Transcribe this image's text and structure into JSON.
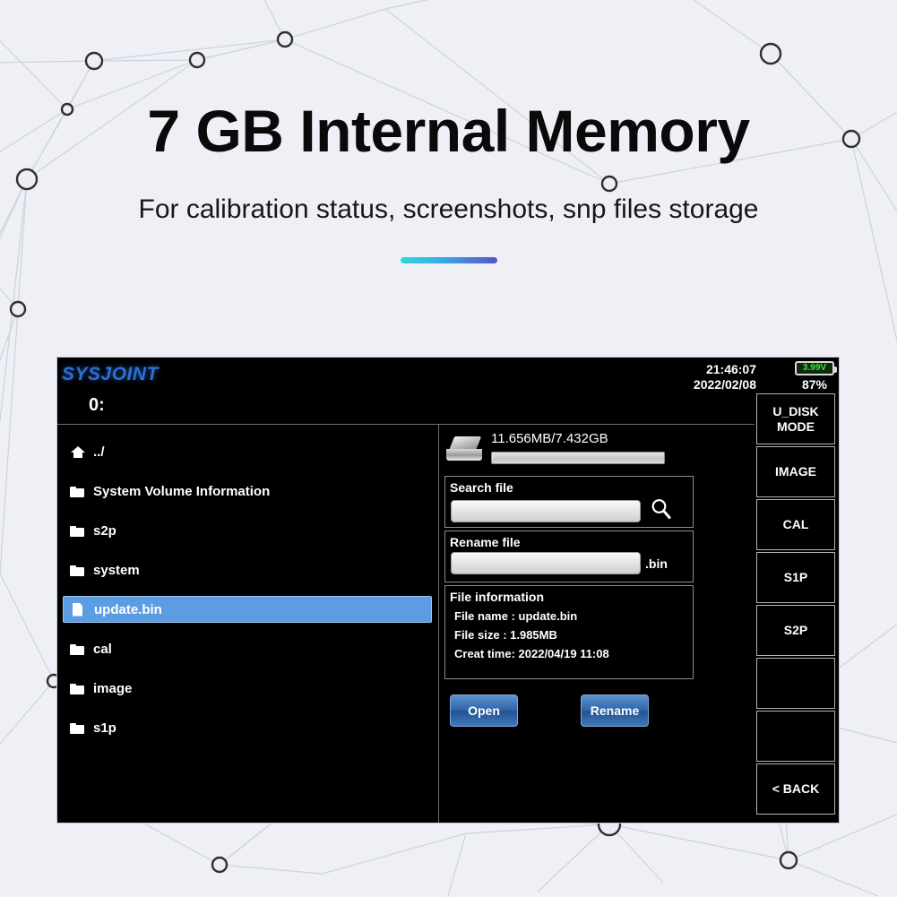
{
  "promo": {
    "title": "7 GB Internal Memory",
    "subtitle": "For calibration status, screenshots, snp files storage",
    "accent_gradient_from": "#2fd8e0",
    "accent_gradient_to": "#5a51c8",
    "background_color": "#eef0f6"
  },
  "device": {
    "brand": "SYSJOINT",
    "brand_color": "#2f6fd4",
    "drive_label": "0:",
    "status": {
      "time": "21:46:07",
      "date": "2022/02/08",
      "battery_voltage": "3.99V",
      "battery_percent": "87%",
      "battery_text_color": "#3ee43e"
    },
    "storage": {
      "used_total": "11.656MB/7.432GB",
      "fill_percent": 1,
      "drive_icon": "hard-drive-icon"
    },
    "file_list": [
      {
        "name": "../",
        "icon": "home-icon",
        "selected": false
      },
      {
        "name": "System Volume Information",
        "icon": "folder-icon",
        "selected": false
      },
      {
        "name": "s2p",
        "icon": "folder-icon",
        "selected": false
      },
      {
        "name": "system",
        "icon": "folder-icon",
        "selected": false
      },
      {
        "name": "update.bin",
        "icon": "file-icon",
        "selected": true
      },
      {
        "name": "cal",
        "icon": "folder-icon",
        "selected": false
      },
      {
        "name": "image",
        "icon": "folder-icon",
        "selected": false
      },
      {
        "name": "s1p",
        "icon": "folder-icon",
        "selected": false
      }
    ],
    "selection_color": "#5b9ce2",
    "search": {
      "label": "Search file",
      "value": "",
      "placeholder": "",
      "icon": "search-icon"
    },
    "rename": {
      "label": "Rename file",
      "value": "",
      "placeholder": "",
      "extension": ".bin"
    },
    "file_information": {
      "label": "File information",
      "file_name": "File name : update.bin",
      "file_size": "File size    : 1.985MB",
      "creat_time": "Creat time: 2022/04/19 11:08"
    },
    "actions": {
      "open": "Open",
      "rename": "Rename"
    },
    "soft_keys": [
      {
        "line1": "U_DISK",
        "line2": "MODE"
      },
      {
        "line1": "IMAGE",
        "line2": ""
      },
      {
        "line1": "CAL",
        "line2": ""
      },
      {
        "line1": "S1P",
        "line2": ""
      },
      {
        "line1": "S2P",
        "line2": ""
      },
      {
        "line1": "",
        "line2": ""
      },
      {
        "line1": "",
        "line2": ""
      },
      {
        "line1": "< BACK",
        "line2": ""
      }
    ]
  }
}
